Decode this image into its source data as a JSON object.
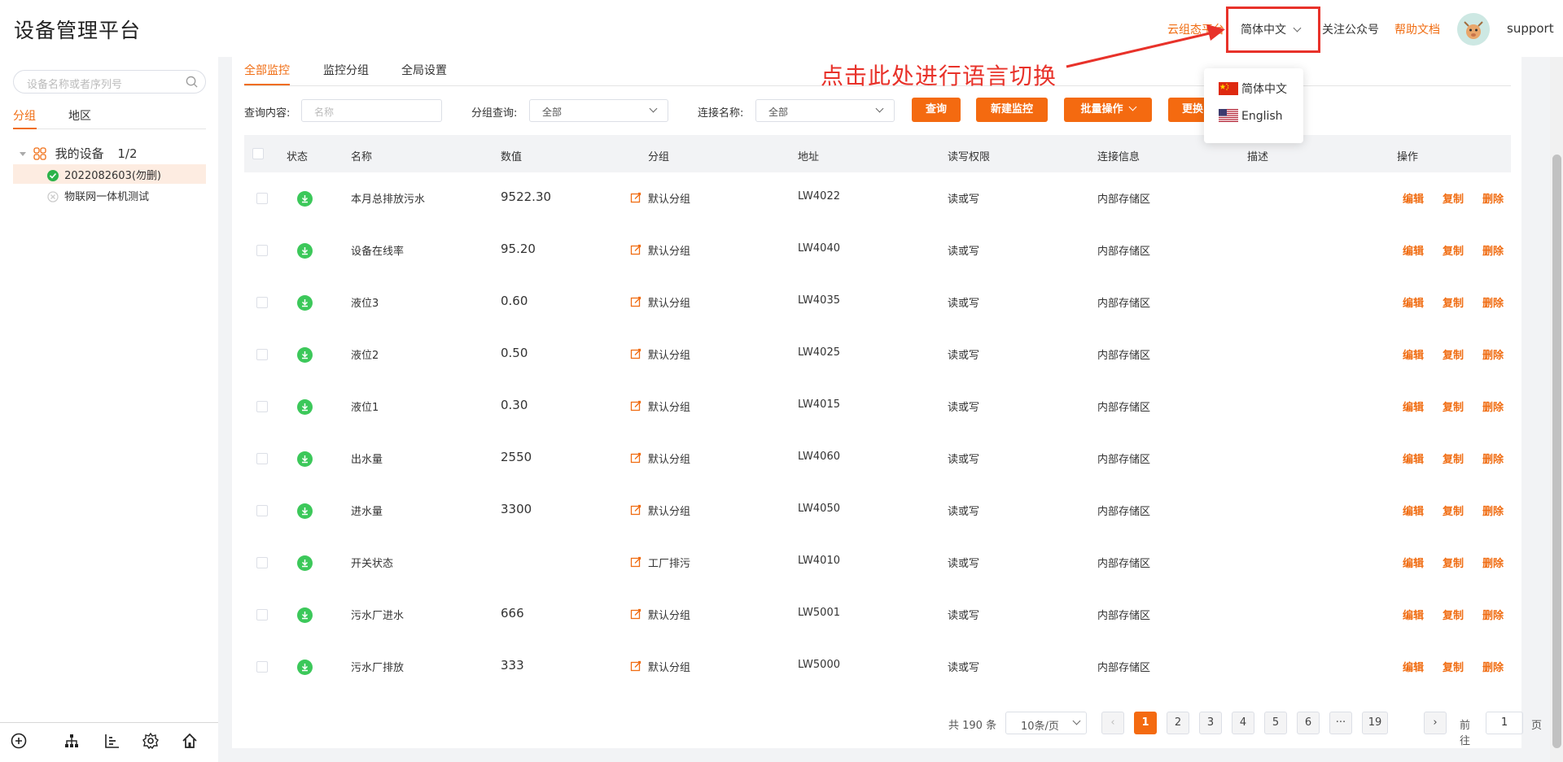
{
  "header": {
    "app_title": "设备管理平台",
    "cloud_link": "云组态平台",
    "language_selected": "简体中文",
    "follow_link": "关注公众号",
    "help_link": "帮助文档",
    "username": "support"
  },
  "language_dropdown": {
    "options": [
      {
        "label": "简体中文",
        "flag": "china-flag-icon"
      },
      {
        "label": "English",
        "flag": "us-flag-icon"
      }
    ]
  },
  "annotation": {
    "callout_text": "点击此处进行语言切换",
    "color": "#e8322a"
  },
  "sidebar": {
    "search_placeholder": "设备名称或者序列号",
    "tabs": [
      "分组",
      "地区"
    ],
    "tree_root_label": "我的设备",
    "tree_root_count": "1/2",
    "devices": [
      {
        "name": "2022082603(勿删)",
        "status": "online"
      },
      {
        "name": "物联网一体机测试",
        "status": "offline"
      }
    ],
    "bottom_icons": [
      "add-circle-icon",
      "org-tree-icon",
      "bar-list-icon",
      "settings-icon",
      "home-icon"
    ]
  },
  "main": {
    "tabs": [
      "全部监控",
      "监控分组",
      "全局设置"
    ],
    "filters": {
      "query_label": "查询内容:",
      "query_placeholder": "名称",
      "group_label": "分组查询:",
      "group_value": "全部",
      "conn_label": "连接名称:",
      "conn_value": "全部"
    },
    "buttons": {
      "search": "查询",
      "new_monitor": "新建监控",
      "batch": "批量操作",
      "replace": "更换"
    },
    "table": {
      "columns": [
        "状态",
        "名称",
        "数值",
        "分组",
        "地址",
        "读写权限",
        "连接信息",
        "描述",
        "操作"
      ],
      "actions": [
        "编辑",
        "复制",
        "删除"
      ],
      "rows": [
        {
          "name": "本月总排放污水",
          "value": "9522.30",
          "group": "默认分组",
          "address": "LW4022",
          "rw": "读或写",
          "conn": "内部存储区",
          "desc": ""
        },
        {
          "name": "设备在线率",
          "value": "95.20",
          "group": "默认分组",
          "address": "LW4040",
          "rw": "读或写",
          "conn": "内部存储区",
          "desc": ""
        },
        {
          "name": "液位3",
          "value": "0.60",
          "group": "默认分组",
          "address": "LW4035",
          "rw": "读或写",
          "conn": "内部存储区",
          "desc": ""
        },
        {
          "name": "液位2",
          "value": "0.50",
          "group": "默认分组",
          "address": "LW4025",
          "rw": "读或写",
          "conn": "内部存储区",
          "desc": ""
        },
        {
          "name": "液位1",
          "value": "0.30",
          "group": "默认分组",
          "address": "LW4015",
          "rw": "读或写",
          "conn": "内部存储区",
          "desc": ""
        },
        {
          "name": "出水量",
          "value": "2550",
          "group": "默认分组",
          "address": "LW4060",
          "rw": "读或写",
          "conn": "内部存储区",
          "desc": ""
        },
        {
          "name": "进水量",
          "value": "3300",
          "group": "默认分组",
          "address": "LW4050",
          "rw": "读或写",
          "conn": "内部存储区",
          "desc": ""
        },
        {
          "name": "开关状态",
          "value": "",
          "group": "工厂排污",
          "address": "LW4010",
          "rw": "读或写",
          "conn": "内部存储区",
          "desc": ""
        },
        {
          "name": "污水厂进水",
          "value": "666",
          "group": "默认分组",
          "address": "LW5001",
          "rw": "读或写",
          "conn": "内部存储区",
          "desc": ""
        },
        {
          "name": "污水厂排放",
          "value": "333",
          "group": "默认分组",
          "address": "LW5000",
          "rw": "读或写",
          "conn": "内部存储区",
          "desc": ""
        }
      ]
    },
    "pagination": {
      "total": "共 190 条",
      "page_size": "10条/页",
      "pages": [
        "1",
        "2",
        "3",
        "4",
        "5",
        "6",
        "···",
        "19"
      ],
      "current": "1",
      "goto_label": "前往",
      "goto_value": "1",
      "page_suffix": "页"
    }
  },
  "colors": {
    "accent": "#f06d13",
    "button": "#f46a10",
    "status_online": "#3cc85a",
    "annotation_red": "#e8322a"
  }
}
